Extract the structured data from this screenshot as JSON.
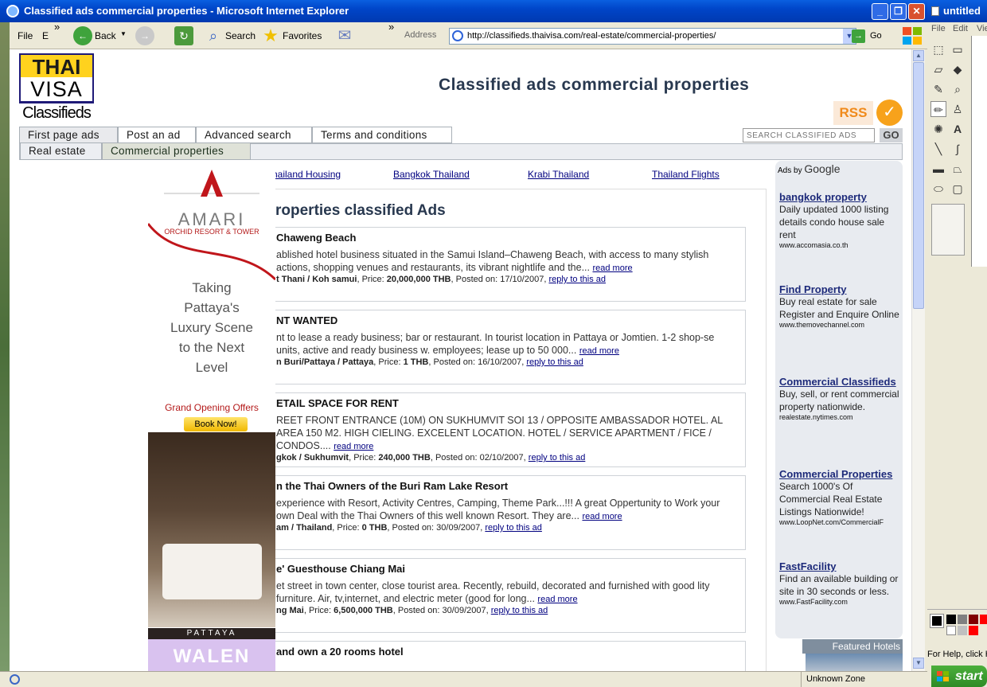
{
  "browser": {
    "title": "Classified ads commercial properties - Microsoft Internet Explorer",
    "menu": {
      "file": "File",
      "edit": "E",
      "more": "»"
    },
    "toolbar": {
      "back": "Back",
      "search": "Search",
      "favorites": "Favorites",
      "more": "»"
    },
    "address_label": "Address",
    "url": "http://classifieds.thaivisa.com/real-estate/commercial-properties/",
    "go": "Go",
    "status_zone": "Unknown Zone"
  },
  "paint": {
    "title": "untitled",
    "menu": {
      "file": "File",
      "edit": "Edit",
      "view": "Vie"
    },
    "status": "For Help, click H",
    "start": "start"
  },
  "site": {
    "logo": {
      "line1": "THAI",
      "line2": "VISA",
      "line3": "Classifieds"
    },
    "page_title": "Classified ads commercial properties",
    "rss": "RSS",
    "nav1": [
      "First page ads",
      "Post an ad",
      "Advanced search",
      "Terms and conditions"
    ],
    "nav2": [
      "Real estate",
      "Commercial properties"
    ],
    "search_placeholder": "SEARCH CLASSIFIED ADS",
    "search_go": "GO",
    "top_links": [
      "hailand Housing",
      "Bangkok Thailand",
      "Krabi Thailand",
      "Thailand Flights"
    ],
    "heading": "roperties classified Ads"
  },
  "banner": {
    "brand": "AMARI",
    "sub": "ORCHID RESORT & TOWER",
    "tagline": "Taking Pattaya's Luxury Scene to the Next Level",
    "grand": "Grand Opening Offers",
    "book": "Book Now!",
    "city": "PATTAYA",
    "second": "WALEN"
  },
  "ads": [
    {
      "title": "Chaweng Beach",
      "desc": "ablished hotel business situated in the Samui Island–Chaweng Beach, with access to many stylish actions, shopping venues and restaurants, its vibrant nightlife and the...",
      "location": "t Thani / Koh samui",
      "price": "20,000,000 THB",
      "posted": "17/10/2007"
    },
    {
      "title": "NT WANTED",
      "desc": "nt to lease a ready business; bar or restaurant. In tourist location in Pattaya or Jomtien. 1-2 shop-se units, active and ready business w. employees; lease up to 50 000...",
      "location": "n Buri/Pattaya / Pattaya",
      "price": "1 THB",
      "posted": "16/10/2007"
    },
    {
      "title": "ETAIL SPACE FOR RENT",
      "desc": "REET FRONT ENTRANCE (10M) ON SUKHUMVIT SOI 13 / OPPOSITE AMBASSADOR HOTEL. AL AREA 150 M2. HIGH CIELING. EXCELENT LOCATION. HOTEL / SERVICE APARTMENT / FICE / CONDOS....",
      "location": "gkok / Sukhumvit",
      "price": "240,000 THB",
      "posted": "02/10/2007"
    },
    {
      "title": "n the Thai Owners of the Buri Ram Lake Resort",
      "desc": "experience with Resort, Activity Centres, Camping, Theme Park...!!! A great Oppertunity to Work your own Deal with the Thai Owners of this well known Resort. They are...",
      "location": "am / Thailand",
      "price": "0 THB",
      "posted": "30/09/2007"
    },
    {
      "title": "e' Guesthouse Chiang Mai",
      "desc": "et street in town center, close tourist area. Recently, rebuild, decorated and furnished with good lity furniture. Air, tv,internet, and electric meter (good for long...",
      "location": "ng Mai",
      "price": "6,500,000 THB",
      "posted": "30/09/2007"
    },
    {
      "title": "and own a 20 rooms hotel",
      "desc": "",
      "location": "",
      "price": "",
      "posted": ""
    }
  ],
  "ad_labels": {
    "price": "Price:",
    "posted": "Posted on:",
    "read_more": "read more",
    "reply": "reply to this ad"
  },
  "google": {
    "ads_by": "Ads by",
    "google": "Google",
    "items": [
      {
        "head": "bangkok property",
        "text": "Daily updated 1000 listing details condo house sale rent",
        "url": "www.accomasia.co.th"
      },
      {
        "head": "Find Property",
        "text": "Buy real estate for sale Register and Enquire Online",
        "url": "www.themovechannel.com"
      },
      {
        "head": "Commercial Classifieds",
        "text": "Buy, sell, or rent commercial property nationwide.",
        "url": "realestate.nytimes.com"
      },
      {
        "head": "Commercial Properties",
        "text": "Search 1000's Of Commercial Real Estate Listings Nationwide!",
        "url": "www.LoopNet.com/CommercialF"
      },
      {
        "head": "FastFacility",
        "text": "Find an available building or site in 30 seconds or less.",
        "url": "www.FastFacility.com"
      }
    ],
    "featured": "Featured Hotels"
  },
  "colors": {
    "xp_blue": "#0a5fe0",
    "heading": "#28384f",
    "link": "#000080",
    "rss": "#f08a1b"
  }
}
